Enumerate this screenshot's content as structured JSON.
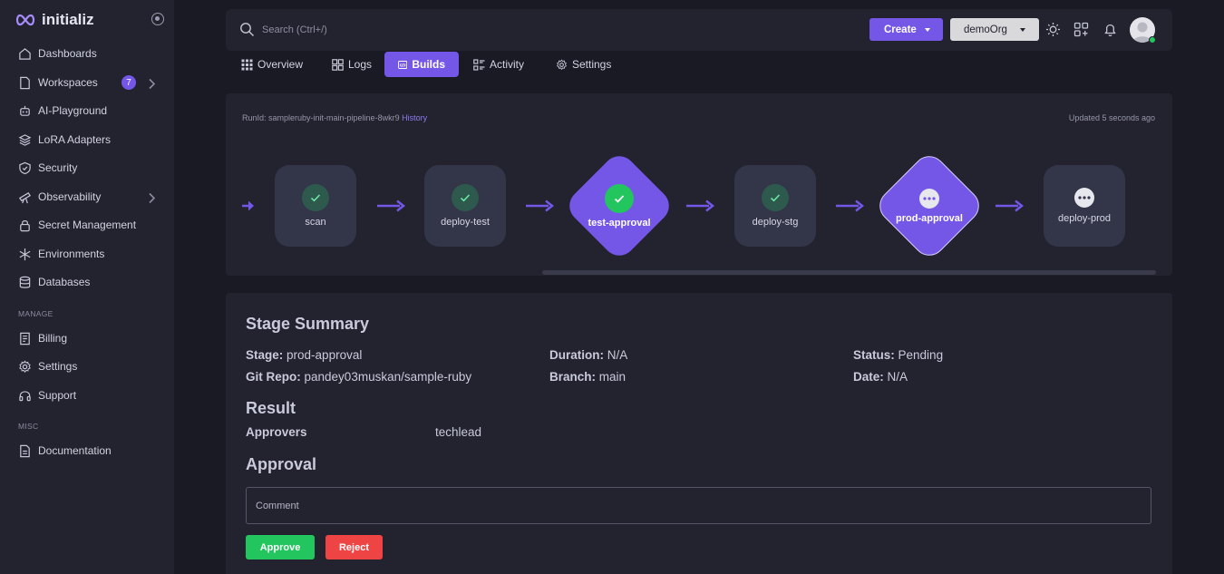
{
  "brand": {
    "name": "initializ"
  },
  "sidebar": {
    "items": [
      {
        "label": "Dashboards"
      },
      {
        "label": "Workspaces",
        "badge": "7"
      },
      {
        "label": "AI-Playground"
      },
      {
        "label": "LoRA Adapters"
      },
      {
        "label": "Security"
      },
      {
        "label": "Observability"
      },
      {
        "label": "Secret Management"
      },
      {
        "label": "Environments"
      },
      {
        "label": "Databases"
      }
    ],
    "manage_label": "MANAGE",
    "manage_items": [
      {
        "label": "Billing"
      },
      {
        "label": "Settings"
      },
      {
        "label": "Support"
      }
    ],
    "misc_label": "MISC",
    "misc_items": [
      {
        "label": "Documentation"
      }
    ]
  },
  "topbar": {
    "search_placeholder": "Search (Ctrl+/)",
    "create_label": "Create",
    "org_label": "demoOrg"
  },
  "tabs": [
    {
      "label": "Overview"
    },
    {
      "label": "Logs"
    },
    {
      "label": "Builds",
      "active": true
    },
    {
      "label": "Activity"
    },
    {
      "label": "Settings"
    }
  ],
  "pipeline": {
    "runid_prefix": "RunId: sampleruby-init-main-pipeline-8wkr9",
    "history_link": "History",
    "updated": "Updated 5 seconds ago",
    "stages": [
      {
        "name": "scan",
        "status": "success",
        "kind": "build"
      },
      {
        "name": "deploy-test",
        "status": "success",
        "kind": "build"
      },
      {
        "name": "test-approval",
        "status": "success",
        "kind": "approval"
      },
      {
        "name": "deploy-stg",
        "status": "success",
        "kind": "build"
      },
      {
        "name": "prod-approval",
        "status": "pending",
        "kind": "approval"
      },
      {
        "name": "deploy-prod",
        "status": "pending",
        "kind": "build"
      }
    ]
  },
  "summary": {
    "title": "Stage Summary",
    "stage_label": "Stage:",
    "stage_value": "prod-approval",
    "duration_label": "Duration:",
    "duration_value": "N/A",
    "status_label": "Status:",
    "status_value": "Pending",
    "repo_label": "Git Repo:",
    "repo_value": "pandey03muskan/sample-ruby",
    "branch_label": "Branch:",
    "branch_value": "main",
    "date_label": "Date:",
    "date_value": "N/A",
    "result_title": "Result",
    "approvers_label": "Approvers",
    "approvers_value": "techlead",
    "approval_title": "Approval",
    "comment_placeholder": "Comment",
    "approve_label": "Approve",
    "reject_label": "Reject"
  },
  "colors": {
    "accent": "#7557e8",
    "success": "#22c55e",
    "danger": "#ef4444",
    "panel": "#22232f",
    "background": "#191a24"
  }
}
